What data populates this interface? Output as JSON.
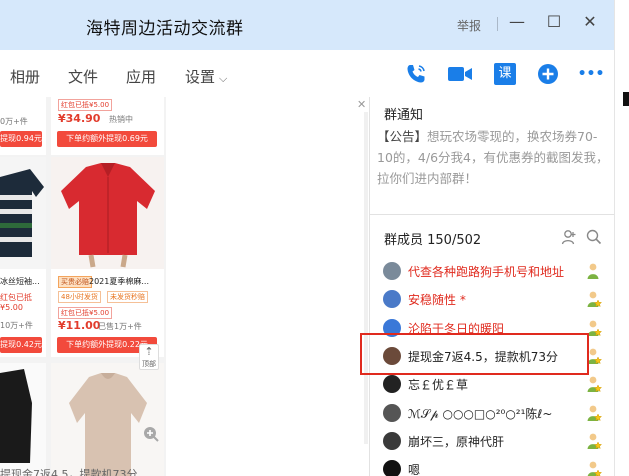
{
  "window": {
    "title": "海特周边活动交流群",
    "report_label": "举报",
    "minimize_glyph": "—",
    "maximize_glyph": "☐",
    "close_glyph": "✕"
  },
  "tabs": [
    {
      "label": "相册"
    },
    {
      "label": "文件"
    },
    {
      "label": "应用"
    },
    {
      "label": "设置"
    }
  ],
  "tab_dropdown_glyph": "⌵",
  "toolbar": {
    "icons": [
      "phone-call-icon",
      "video-call-icon",
      "lesson-icon",
      "add-icon",
      "more-icon"
    ],
    "lesson_label": "课",
    "more_label": "•••"
  },
  "products": {
    "top_left": {
      "price_tail": "0万+件",
      "button": "提现0.94元"
    },
    "top_right": {
      "badge": "红包已抵¥5.00",
      "price": "¥34.90",
      "sold": "热销中",
      "button": "下单约额外提现0.69元"
    },
    "mid_left": {
      "title": "冰丝短袖...",
      "badge": "红包已抵¥5.00",
      "sold": "10万+件",
      "button": "提现0.42元"
    },
    "mid_right": {
      "title_tag": "买贵必赔",
      "title": "2021夏季棉麻...",
      "tags": [
        "48小时发货",
        "未发货秒赔"
      ],
      "badge": "红包已抵¥5.00",
      "price": "¥11.00",
      "sold": "已售1万+件",
      "button": "下单约额外提现0.22元"
    },
    "scroll_top_label": "顶部",
    "close_glyph": "✕"
  },
  "bottom_text": "提现金7返4.5，提款机73分",
  "notice": {
    "title": "群通知",
    "prefix": "【公告】",
    "body_muted": "想玩农场零现的，换农场券70-10的，4/6分我4，有优惠券的截图发我，拉你们进内部群！"
  },
  "members": {
    "title": "群成员 150/502",
    "list": [
      {
        "name": "代查各种跑路狗手机号和地址",
        "color": "#e02a1e",
        "avatar_color": "#7a8a9a",
        "role": "owner"
      },
      {
        "name": "安稳随性 *",
        "color": "#e02a1e",
        "avatar_color": "#4a7ac8",
        "role": "admin"
      },
      {
        "name": "沦陷于冬日的暖阳",
        "color": "#e02a1e",
        "avatar_color": "#3a78d8",
        "role": "admin"
      },
      {
        "name": "提现金7返4.5，提款机73分",
        "color": "#222222",
        "avatar_color": "#6b4a3a",
        "role": "admin"
      },
      {
        "name": "忘￡优￡草",
        "color": "#222222",
        "avatar_color": "#222222",
        "role": "admin"
      },
      {
        "name": "ℳ𝒮𝓅 ○○○□○²⁰○²¹陈ℓ~",
        "color": "#222222",
        "avatar_color": "#555555",
        "role": "admin"
      },
      {
        "name": "崩坏三，原神代肝",
        "color": "#222222",
        "avatar_color": "#3a3a3a",
        "role": "admin"
      },
      {
        "name": "嗯",
        "color": "#222222",
        "avatar_color": "#111111",
        "role": "admin"
      }
    ]
  },
  "colors": {
    "titlebar_bg": "#d6e8fb",
    "accent_blue": "#1a7ee8",
    "danger_red": "#e02a1e",
    "price_red": "#e23c2c"
  }
}
